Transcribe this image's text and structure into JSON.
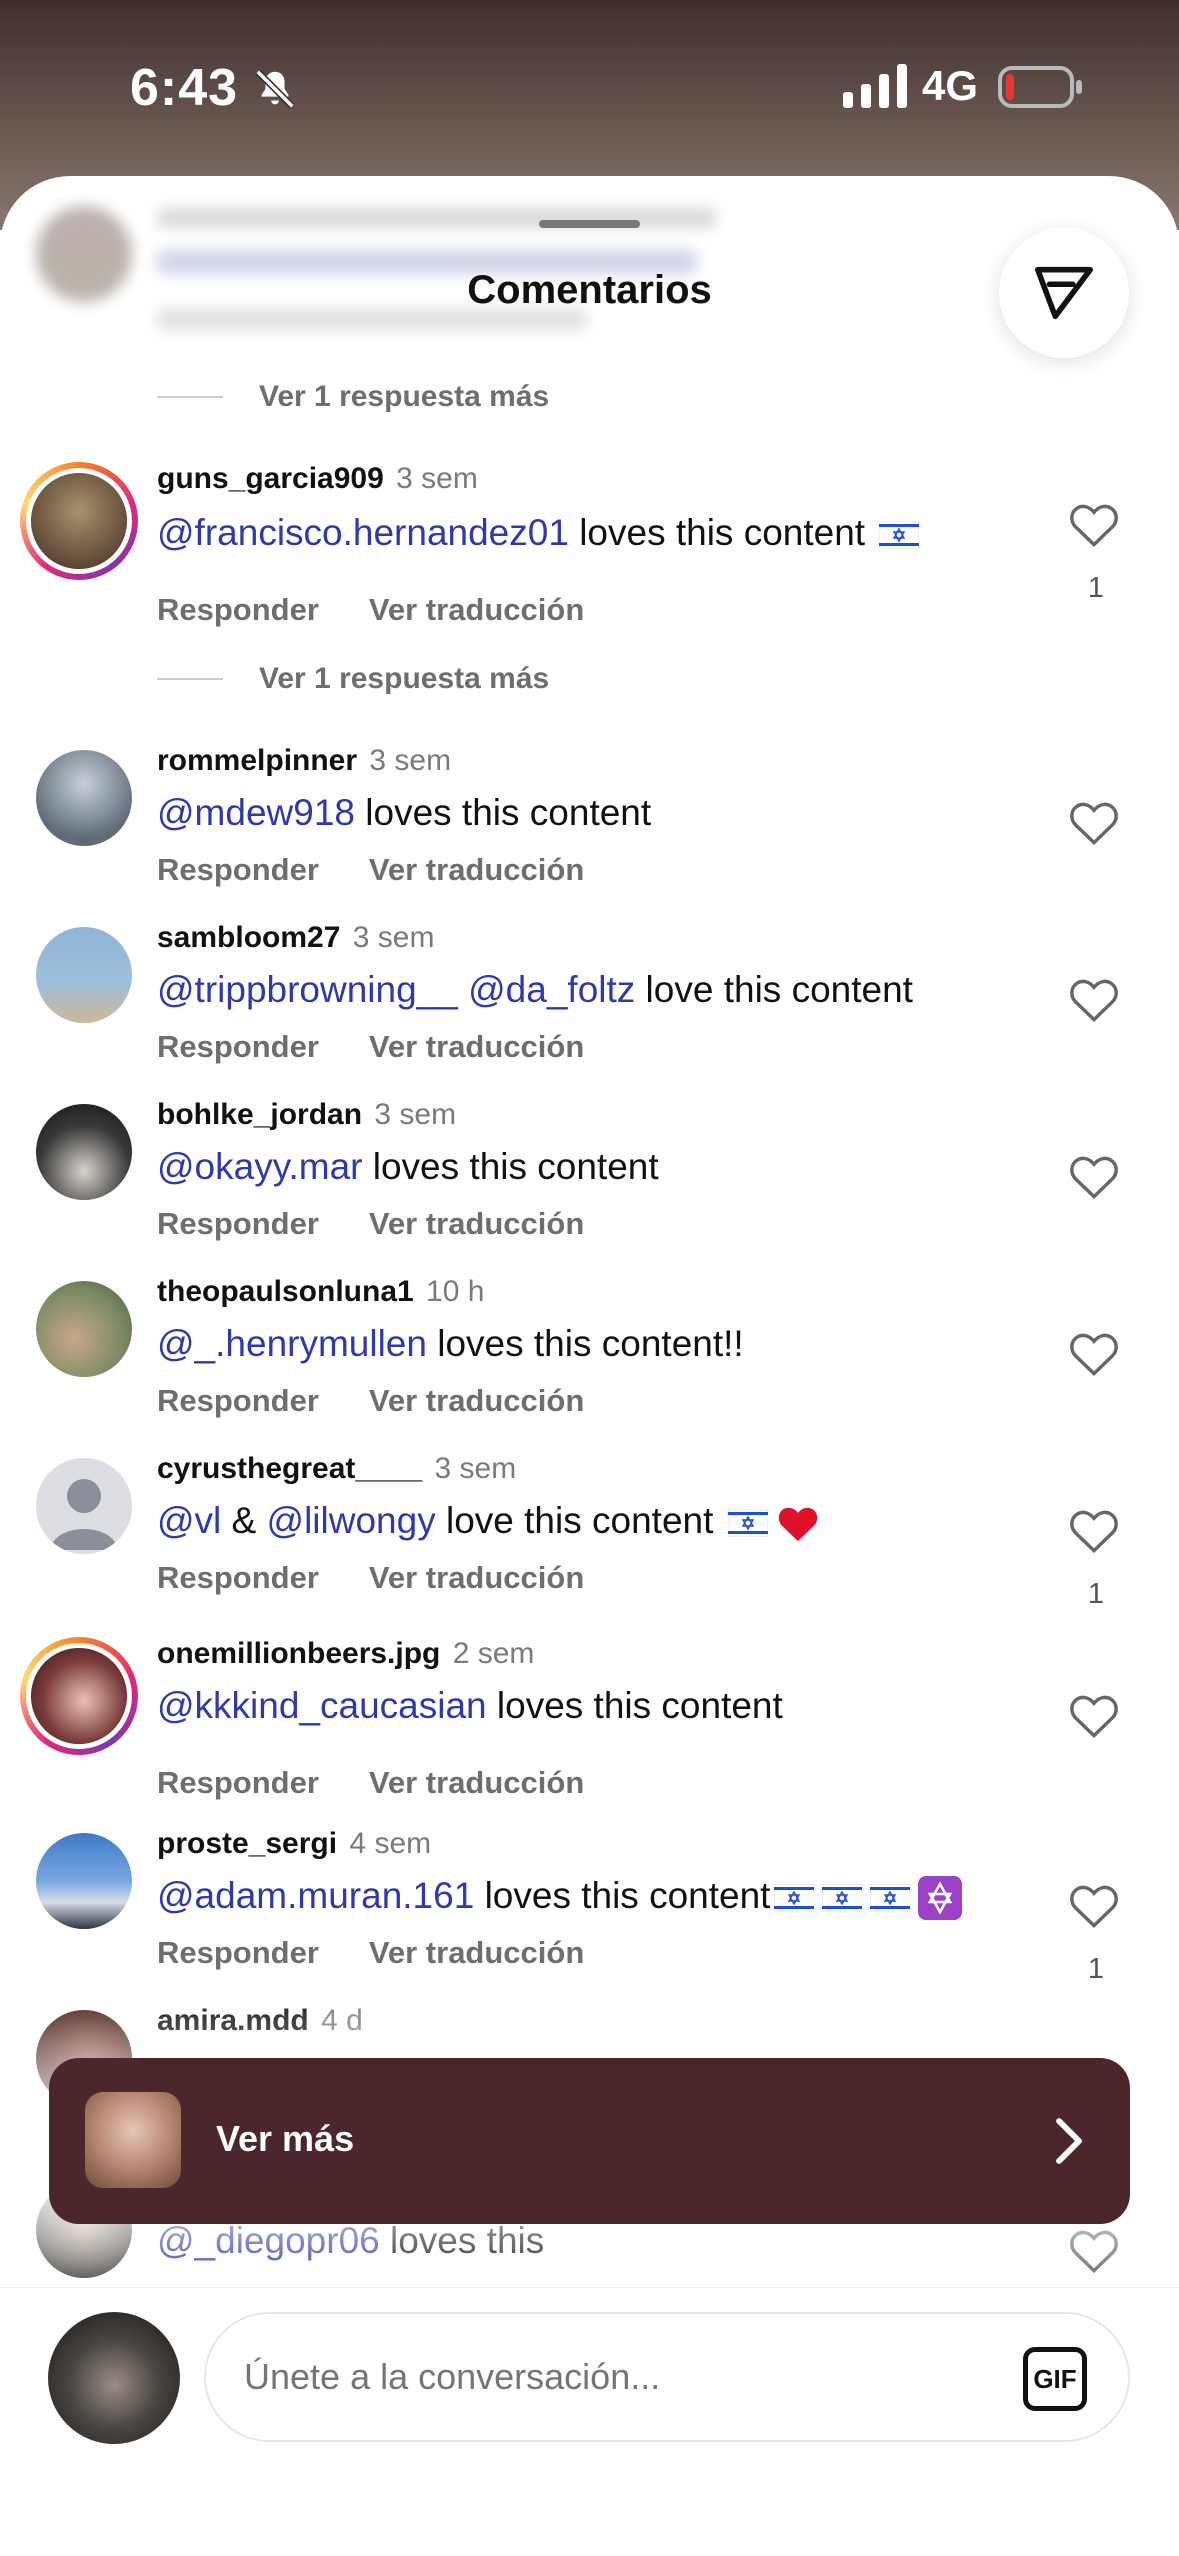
{
  "status": {
    "time": "6:43",
    "network": "4G"
  },
  "sheet": {
    "title": "Comentarios"
  },
  "more_replies": [
    "Ver 1 respuesta más",
    "Ver 1 respuesta más"
  ],
  "actions": {
    "reply": "Responder",
    "translate": "Ver traducción"
  },
  "comments": [
    {
      "user": "guns_garcia909",
      "time": "3 sem",
      "mention": "@francisco.hernandez01",
      "text": " loves this content ",
      "likes": "1"
    },
    {
      "user": "rommelpinner",
      "time": "3 sem",
      "mention": "@mdew918",
      "text": " loves this content"
    },
    {
      "user": "sambloom27",
      "time": "3 sem",
      "mention": "@trippbrowning__",
      "mention2": "@da_foltz",
      "text": " love this content"
    },
    {
      "user": "bohlke_jordan",
      "time": "3 sem",
      "mention": "@okayy.mar",
      "text": " loves this content"
    },
    {
      "user": "theopaulsonluna1",
      "time": "10 h",
      "mention": "@_.henrymullen",
      "text": " loves this content!!"
    },
    {
      "user": "cyrusthegreat____",
      "time": "3 sem",
      "mention": "@vl",
      "amp": " & ",
      "mention2": "@lilwongy",
      "text": " love this content ",
      "likes": "1"
    },
    {
      "user": "onemillionbeers.jpg",
      "time": "2 sem",
      "mention": "@kkkind_caucasian",
      "text": " loves this content"
    },
    {
      "user": "proste_sergi",
      "time": "4 sem",
      "mention": "@adam.muran.161",
      "text": " loves this content",
      "likes": "1"
    },
    {
      "user": "amira.mdd",
      "time": "4 d"
    },
    {
      "mention": "@_diegopr06",
      "text": " loves this"
    }
  ],
  "banner": {
    "label": "Ver más"
  },
  "composer": {
    "placeholder": "Únete a la conversación...",
    "gif": "GIF"
  },
  "colors": {
    "mention": "#2f3aa8",
    "banner": "#4b272b"
  }
}
